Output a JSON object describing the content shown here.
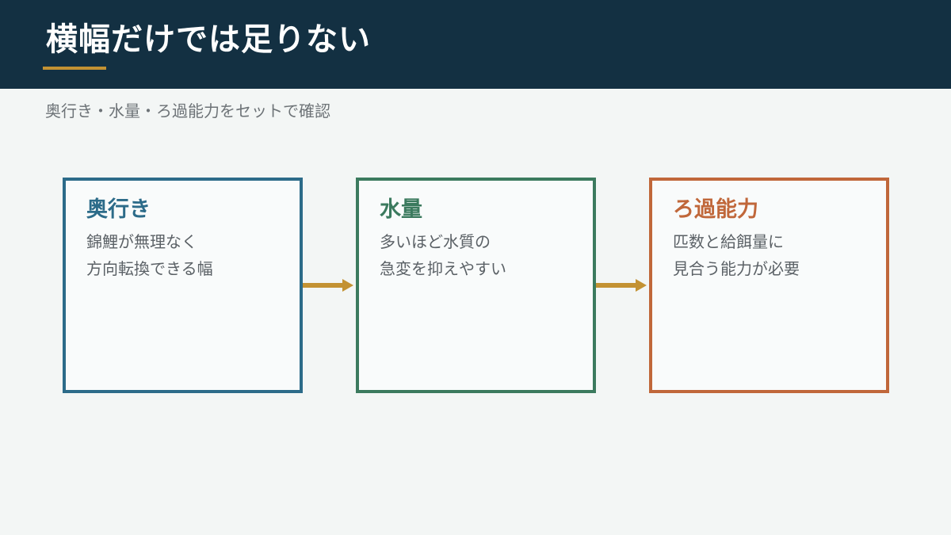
{
  "header": {
    "title": "横幅だけでは足りない"
  },
  "subtitle": "奥行き・水量・ろ過能力をセットで確認",
  "colors": {
    "header_bg": "#133042",
    "accent": "#c39233",
    "depth": "#2c6b89",
    "water": "#3b7a5e",
    "filter": "#c0673a"
  },
  "cards": [
    {
      "title": "奥行き",
      "lines": [
        "錦鯉が無理なく",
        "方向転換できる幅"
      ]
    },
    {
      "title": "水量",
      "lines": [
        "多いほど水質の",
        "急変を抑えやすい"
      ]
    },
    {
      "title": "ろ過能力",
      "lines": [
        "匹数と給餌量に",
        "見合う能力が必要"
      ]
    }
  ]
}
